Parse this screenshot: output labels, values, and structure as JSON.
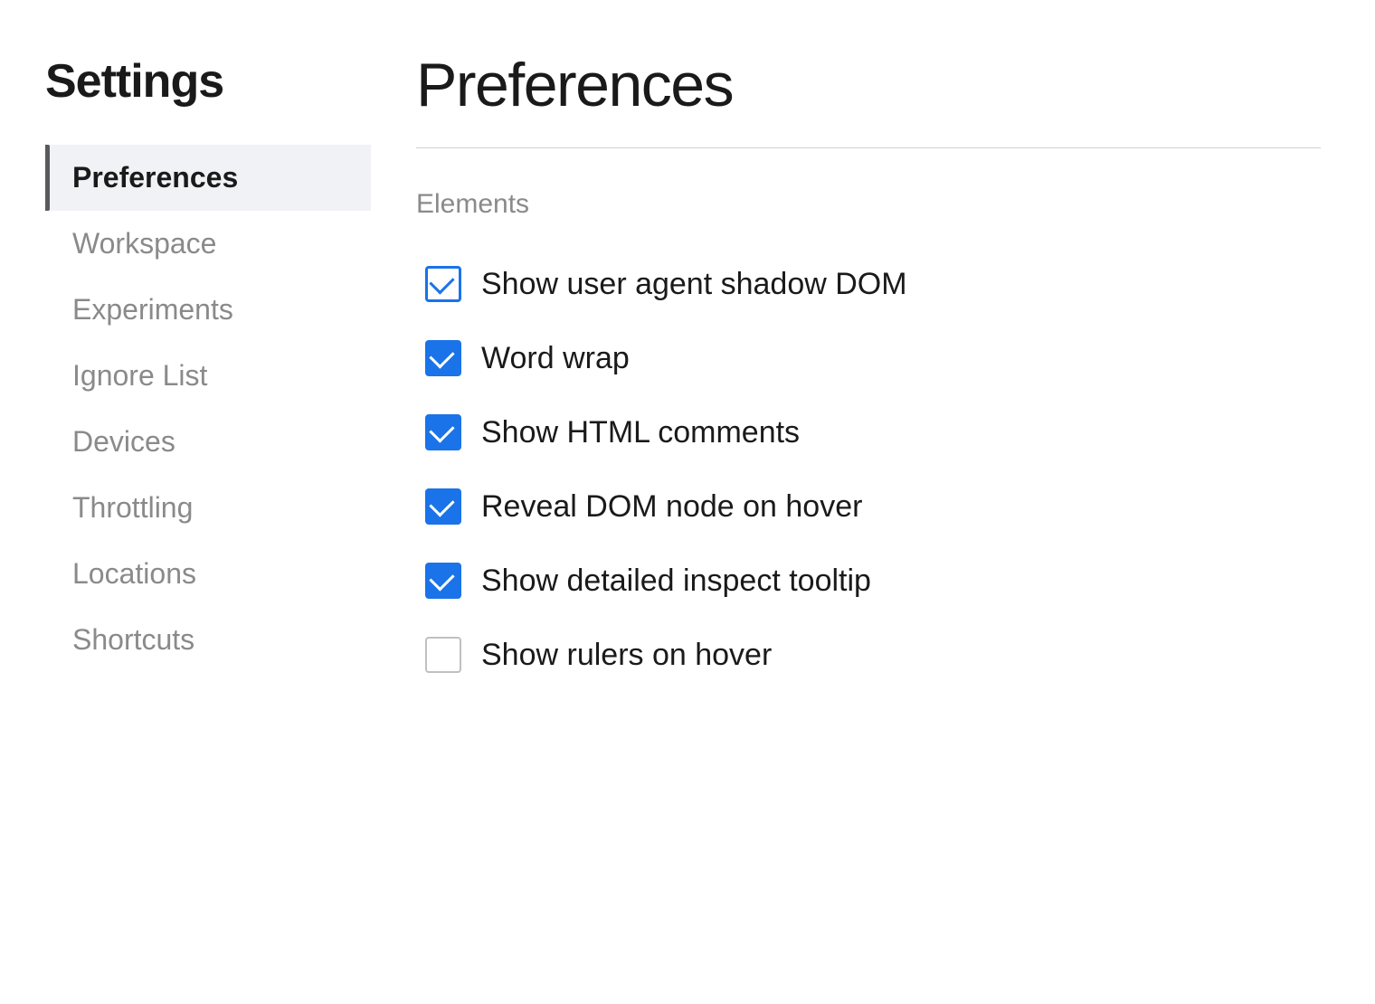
{
  "sidebar": {
    "title": "Settings",
    "items": [
      {
        "id": "preferences",
        "label": "Preferences",
        "active": true
      },
      {
        "id": "workspace",
        "label": "Workspace",
        "active": false
      },
      {
        "id": "experiments",
        "label": "Experiments",
        "active": false
      },
      {
        "id": "ignore-list",
        "label": "Ignore List",
        "active": false
      },
      {
        "id": "devices",
        "label": "Devices",
        "active": false
      },
      {
        "id": "throttling",
        "label": "Throttling",
        "active": false
      },
      {
        "id": "locations",
        "label": "Locations",
        "active": false
      },
      {
        "id": "shortcuts",
        "label": "Shortcuts",
        "active": false
      }
    ]
  },
  "main": {
    "title": "Preferences",
    "sections": [
      {
        "id": "elements",
        "label": "Elements",
        "checkboxes": [
          {
            "id": "shadow-dom",
            "label": "Show user agent shadow DOM",
            "checked": true,
            "outlined": true
          },
          {
            "id": "word-wrap",
            "label": "Word wrap",
            "checked": true,
            "outlined": false
          },
          {
            "id": "html-comments",
            "label": "Show HTML comments",
            "checked": true,
            "outlined": false
          },
          {
            "id": "reveal-dom",
            "label": "Reveal DOM node on hover",
            "checked": true,
            "outlined": false
          },
          {
            "id": "inspect-tooltip",
            "label": "Show detailed inspect tooltip",
            "checked": true,
            "outlined": false
          },
          {
            "id": "rulers-hover",
            "label": "Show rulers on hover",
            "checked": false,
            "outlined": false
          }
        ]
      }
    ]
  },
  "colors": {
    "checked_blue": "#1a73e8",
    "sidebar_active_bg": "#f0f2f5",
    "sidebar_active_bar": "#5a5a5a",
    "text_muted": "#8a8a8a",
    "divider": "#d0d0d0"
  }
}
